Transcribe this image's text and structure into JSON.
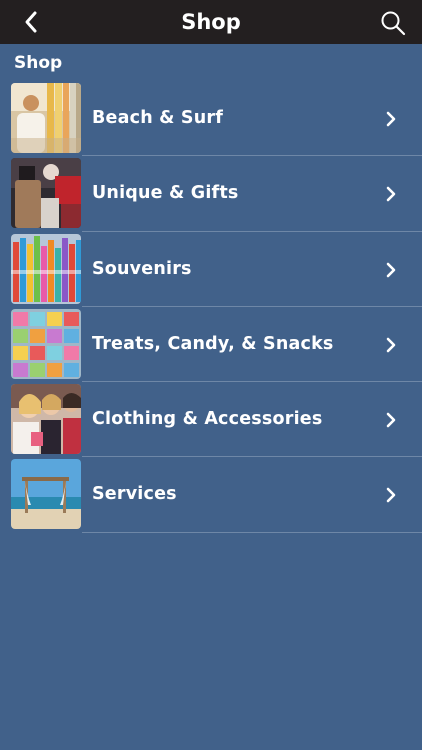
{
  "header": {
    "title": "Shop",
    "back_icon": "chevron-left-icon",
    "search_icon": "search-icon"
  },
  "section": {
    "title": "Shop"
  },
  "items": [
    {
      "label": "Beach & Surf",
      "thumb": "beach-surf-thumbnail"
    },
    {
      "label": "Unique & Gifts",
      "thumb": "unique-gifts-thumbnail"
    },
    {
      "label": "Souvenirs",
      "thumb": "souvenirs-thumbnail"
    },
    {
      "label": "Treats, Candy, & Snacks",
      "thumb": "treats-candy-thumbnail"
    },
    {
      "label": "Clothing & Accessories",
      "thumb": "clothing-accessories-thumbnail"
    },
    {
      "label": "Services",
      "thumb": "services-thumbnail"
    }
  ],
  "colors": {
    "background": "#41618a",
    "navbar": "#231f20",
    "text": "#ffffff",
    "divider": "#6e87a7"
  }
}
